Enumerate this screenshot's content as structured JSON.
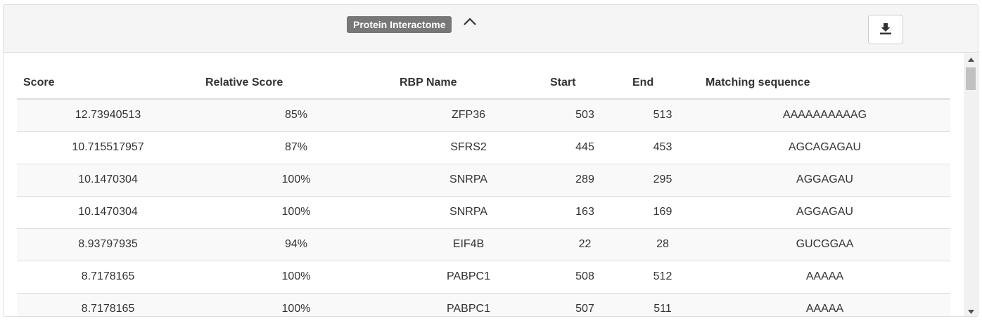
{
  "header": {
    "title": "Protein Interactome",
    "collapse_icon": "chevron-up-icon",
    "download_icon": "download-icon"
  },
  "table": {
    "columns": [
      "Score",
      "Relative Score",
      "RBP Name",
      "Start",
      "End",
      "Matching sequence"
    ],
    "rows": [
      [
        "12.73940513",
        "85%",
        "ZFP36",
        "503",
        "513",
        "AAAAAAAAAAG"
      ],
      [
        "10.715517957",
        "87%",
        "SFRS2",
        "445",
        "453",
        "AGCAGAGAU"
      ],
      [
        "10.1470304",
        "100%",
        "SNRPA",
        "289",
        "295",
        "AGGAGAU"
      ],
      [
        "10.1470304",
        "100%",
        "SNRPA",
        "163",
        "169",
        "AGGAGAU"
      ],
      [
        "8.93797935",
        "94%",
        "EIF4B",
        "22",
        "28",
        "GUCGGAA"
      ],
      [
        "8.7178165",
        "100%",
        "PABPC1",
        "508",
        "512",
        "AAAAA"
      ],
      [
        "8.7178165",
        "100%",
        "PABPC1",
        "507",
        "511",
        "AAAAA"
      ]
    ]
  },
  "colors": {
    "badge": "#777777",
    "stripe": "#f9f9f9",
    "border": "#dddddd"
  }
}
